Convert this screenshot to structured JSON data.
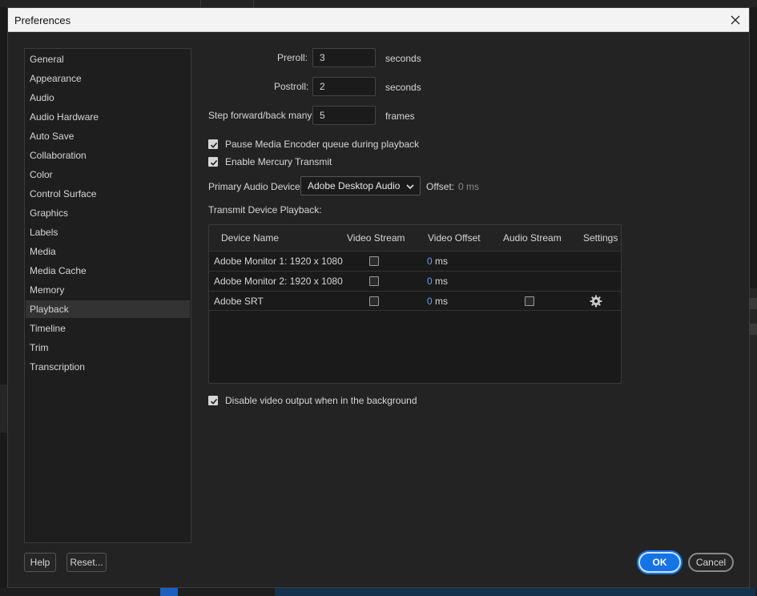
{
  "window": {
    "title": "Preferences"
  },
  "sidebar": {
    "items": [
      {
        "label": "General"
      },
      {
        "label": "Appearance"
      },
      {
        "label": "Audio"
      },
      {
        "label": "Audio Hardware"
      },
      {
        "label": "Auto Save"
      },
      {
        "label": "Collaboration"
      },
      {
        "label": "Color"
      },
      {
        "label": "Control Surface"
      },
      {
        "label": "Graphics"
      },
      {
        "label": "Labels"
      },
      {
        "label": "Media"
      },
      {
        "label": "Media Cache"
      },
      {
        "label": "Memory"
      },
      {
        "label": "Playback",
        "selected": true
      },
      {
        "label": "Timeline"
      },
      {
        "label": "Trim"
      },
      {
        "label": "Transcription"
      }
    ]
  },
  "playback": {
    "preroll": {
      "label": "Preroll:",
      "value": "3",
      "unit": "seconds"
    },
    "postroll": {
      "label": "Postroll:",
      "value": "2",
      "unit": "seconds"
    },
    "step": {
      "label": "Step forward/back many:",
      "value": "5",
      "unit": "frames"
    },
    "pause_encoder": {
      "label": "Pause Media Encoder queue during playback",
      "checked": true
    },
    "mercury": {
      "label": "Enable Mercury Transmit",
      "checked": true
    },
    "audio_device": {
      "label": "Primary Audio Device:",
      "value": "Adobe Desktop Audio",
      "offset_label": "Offset:",
      "offset_value": "0 ms"
    },
    "transmit_label": "Transmit Device Playback:",
    "table": {
      "headers": [
        "Device Name",
        "Video Stream",
        "Video Offset",
        "Audio Stream",
        "Settings"
      ],
      "rows": [
        {
          "name": "Adobe Monitor 1: 1920 x 1080",
          "video_stream": false,
          "offset": "0",
          "unit": "ms"
        },
        {
          "name": "Adobe Monitor 2: 1920 x 1080",
          "video_stream": false,
          "offset": "0",
          "unit": "ms"
        },
        {
          "name": "Adobe SRT",
          "video_stream": false,
          "offset": "0",
          "unit": "ms",
          "audio_stream": false,
          "settings_icon": "gear-icon"
        }
      ]
    },
    "disable_bg": {
      "label": "Disable video output when in the background",
      "checked": true
    }
  },
  "footer": {
    "help": "Help",
    "reset": "Reset...",
    "ok": "OK",
    "cancel": "Cancel"
  },
  "colors": {
    "accent": "#1473e6",
    "offset_value": "#5aa2ff"
  }
}
